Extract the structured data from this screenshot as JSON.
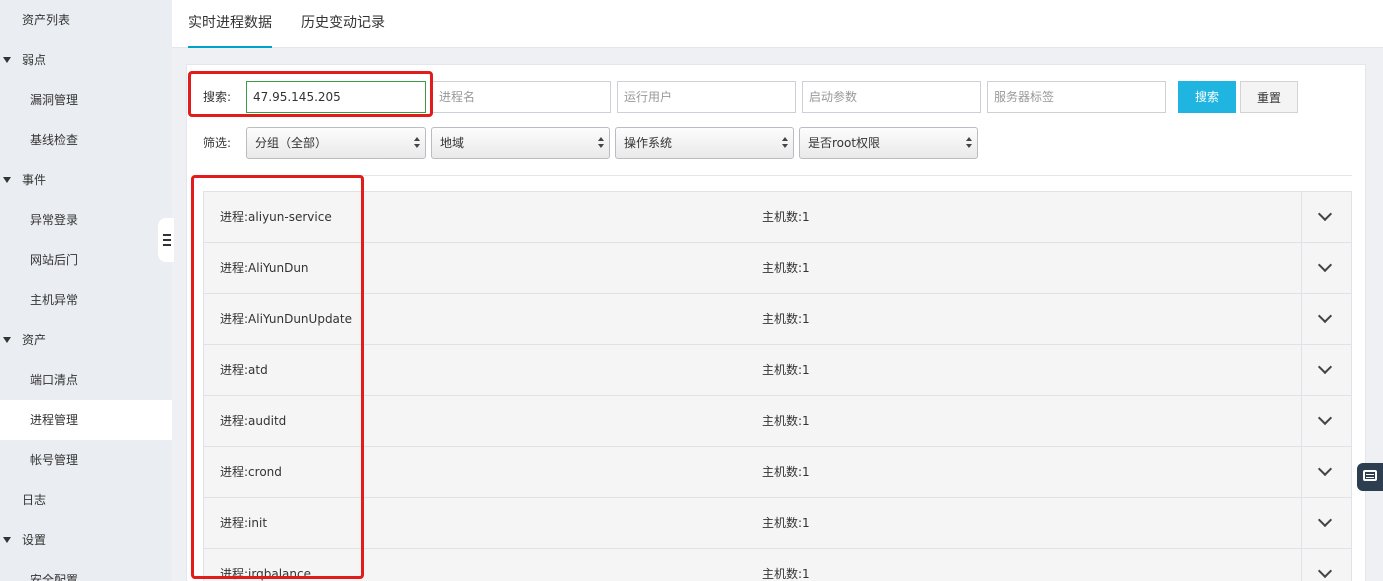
{
  "sidebar": {
    "assets_list": "资产列表",
    "weakness": {
      "label": "弱点",
      "items": [
        "漏洞管理",
        "基线检查"
      ]
    },
    "events": {
      "label": "事件",
      "items": [
        "异常登录",
        "网站后门",
        "主机异常"
      ]
    },
    "assets": {
      "label": "资产",
      "items": [
        "端口清点",
        "进程管理",
        "帐号管理"
      ],
      "active": "进程管理"
    },
    "logs": "日志",
    "settings": {
      "label": "设置",
      "items": [
        "安全配置"
      ]
    }
  },
  "tabs": {
    "realtime": "实时进程数据",
    "history": "历史变动记录",
    "active": "实时进程数据"
  },
  "search": {
    "label": "搜索:",
    "ip_value": "47.95.145.205",
    "process_placeholder": "进程名",
    "user_placeholder": "运行用户",
    "args_placeholder": "启动参数",
    "tag_placeholder": "服务器标签",
    "search_button": "搜索",
    "reset_button": "重置"
  },
  "filter": {
    "label": "筛选:",
    "group": "分组（全部）",
    "region": "地域",
    "os": "操作系统",
    "root": "是否root权限"
  },
  "processes": {
    "proc_label": "进程:",
    "hosts_label": "主机数:",
    "items": [
      {
        "name": "aliyun-service",
        "hosts": "1"
      },
      {
        "name": "AliYunDun",
        "hosts": "1"
      },
      {
        "name": "AliYunDunUpdate",
        "hosts": "1"
      },
      {
        "name": "atd",
        "hosts": "1"
      },
      {
        "name": "auditd",
        "hosts": "1"
      },
      {
        "name": "crond",
        "hosts": "1"
      },
      {
        "name": "init",
        "hosts": "1"
      },
      {
        "name": "irqbalance",
        "hosts": "1"
      }
    ]
  },
  "colors": {
    "accent": "#00a2ca",
    "primary_button": "#1fb5e0",
    "highlight_box": "#e21b1b",
    "focus_border": "#3d9b46"
  }
}
